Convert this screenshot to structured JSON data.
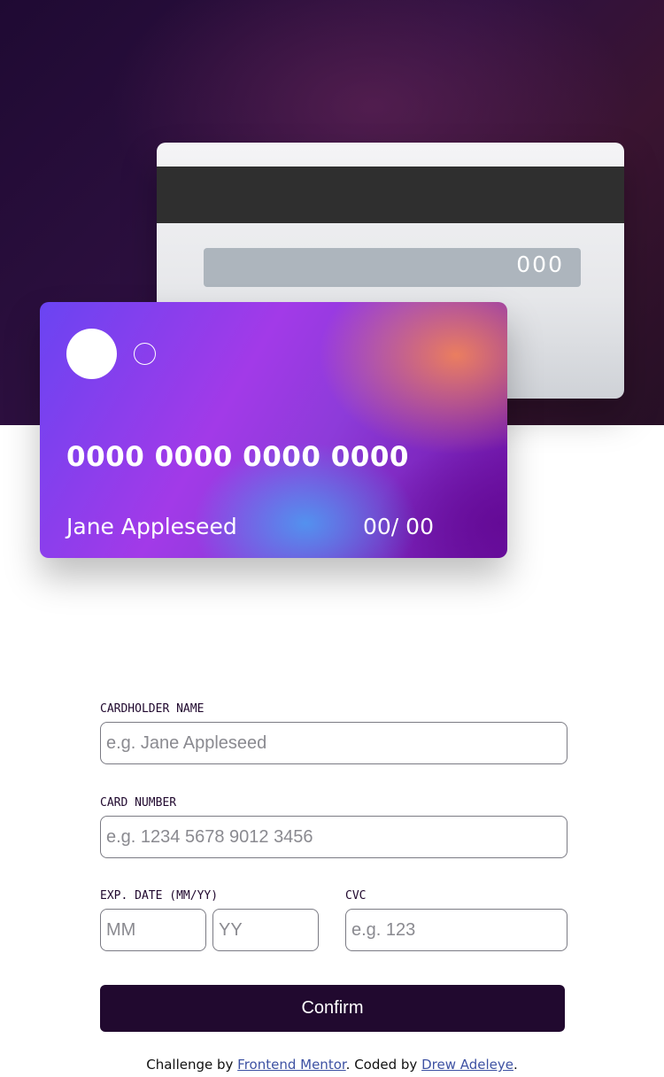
{
  "card_back": {
    "cvc": "000"
  },
  "card_front": {
    "number": "0000 0000 0000 0000",
    "name": "Jane Appleseed",
    "expiry": "00/ 00"
  },
  "form": {
    "name_label": "CARDHOLDER NAME",
    "name_placeholder": "e.g. Jane Appleseed",
    "number_label": "CARD NUMBER",
    "number_placeholder": "e.g. 1234 5678 9012 3456",
    "exp_label": "EXP. DATE (MM/YY)",
    "month_placeholder": "MM",
    "year_placeholder": "YY",
    "cvc_label": "CVC",
    "cvc_placeholder": "e.g. 123",
    "confirm_label": "Confirm"
  },
  "footer": {
    "prefix": "Challenge by ",
    "link1": "Frontend Mentor",
    "middle": ". Coded by ",
    "link2": "Drew Adeleye",
    "suffix": "."
  },
  "colors": {
    "hero_bg": "#271026",
    "accent_dark": "#21092f",
    "link": "#3e52a3"
  }
}
